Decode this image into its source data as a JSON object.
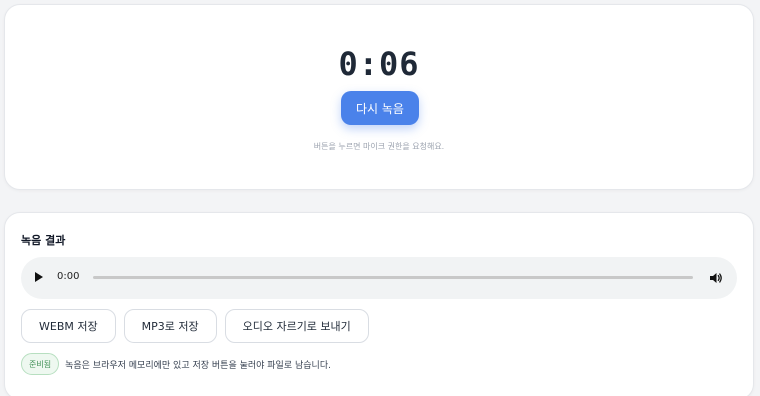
{
  "recorder": {
    "timer": "0:06",
    "button_label": "다시 녹음",
    "hint": "버튼을 누르면 마이크 권한을 요청해요."
  },
  "result": {
    "title": "녹음 결과",
    "player": {
      "current_time": "0:00",
      "progress_fraction": 0
    },
    "actions": {
      "webm_label": "WEBM 저장",
      "mp3_label": "MP3로 저장",
      "send_label": "오디오 자르기로 보내기"
    },
    "status": {
      "badge": "준비됨",
      "message": "녹음은 브라우저 메모리에만 있고 저장 버튼을 눌러야 파일로 남습니다."
    }
  },
  "colors": {
    "accent": "#4a82ea",
    "badge_green": "#3f8f55",
    "page_bg": "#f3f4f6"
  },
  "icons": {
    "play": "play-icon",
    "volume": "volume-icon"
  }
}
